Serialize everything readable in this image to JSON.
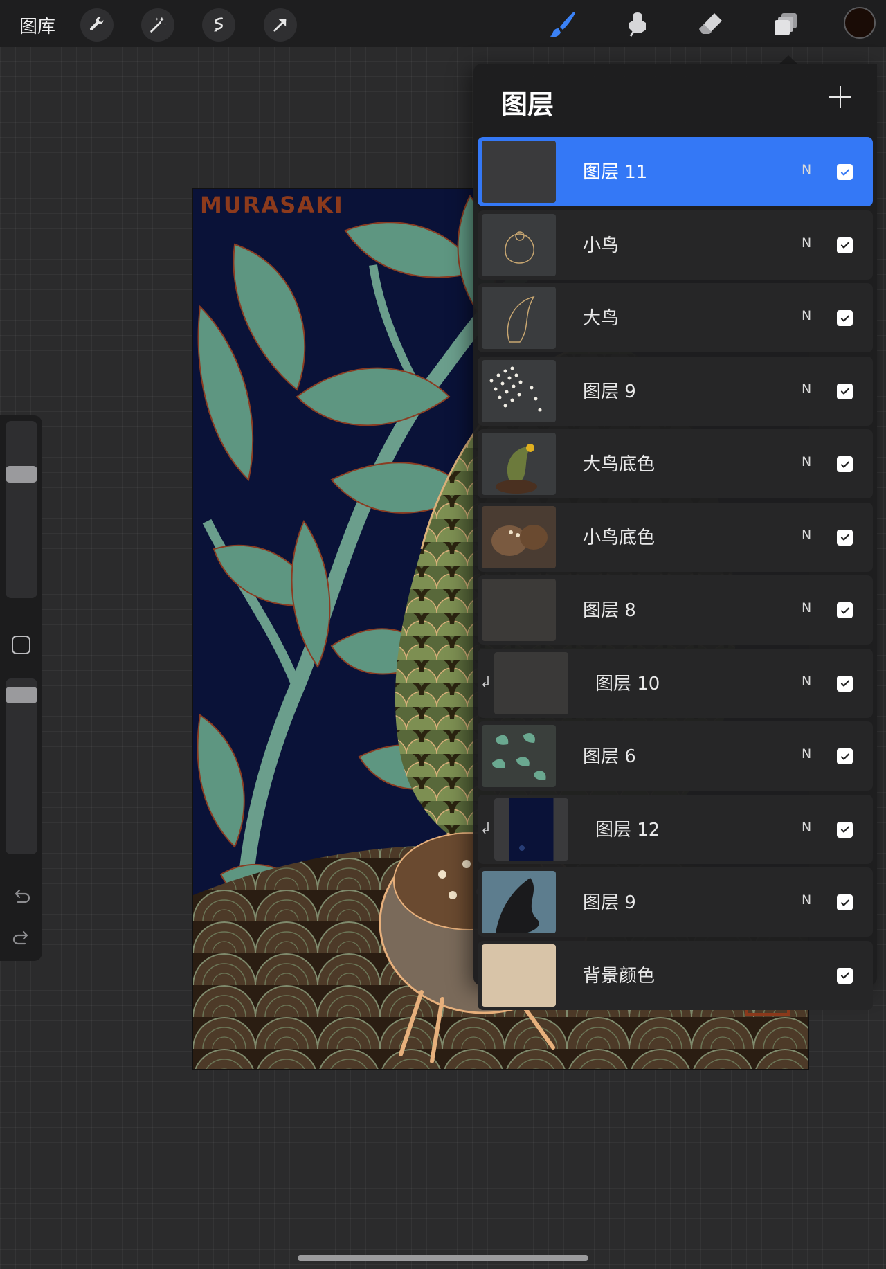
{
  "topbar": {
    "gallery_label": "图库",
    "actions": [
      "wrench-icon",
      "magic-wand-icon",
      "selection-icon",
      "transform-arrow-icon"
    ],
    "tools": [
      "brush-icon",
      "smudge-icon",
      "eraser-icon",
      "layers-icon"
    ],
    "active_tool": "brush-icon",
    "current_color": "#1a0c06",
    "accent": "#3478f6"
  },
  "sidebar": {
    "brush_size_level": 0.72,
    "opacity_level": 0.95,
    "undo_icon": "undo-icon",
    "redo_icon": "redo-icon"
  },
  "canvas": {
    "watermark": "MURASAKI",
    "background": "#0a1238"
  },
  "layers_panel": {
    "title": "图层",
    "add_icon": "plus-icon",
    "layers": [
      {
        "name": "图层 11",
        "blend": "N",
        "visible": true,
        "selected": true,
        "clipped": false
      },
      {
        "name": "小鸟",
        "blend": "N",
        "visible": true,
        "selected": false,
        "clipped": false
      },
      {
        "name": "大鸟",
        "blend": "N",
        "visible": true,
        "selected": false,
        "clipped": false
      },
      {
        "name": "图层 9",
        "blend": "N",
        "visible": true,
        "selected": false,
        "clipped": false
      },
      {
        "name": "大鸟底色",
        "blend": "N",
        "visible": true,
        "selected": false,
        "clipped": false
      },
      {
        "name": "小鸟底色",
        "blend": "N",
        "visible": true,
        "selected": false,
        "clipped": false
      },
      {
        "name": "图层 8",
        "blend": "N",
        "visible": true,
        "selected": false,
        "clipped": false
      },
      {
        "name": "图层 10",
        "blend": "N",
        "visible": true,
        "selected": false,
        "clipped": true
      },
      {
        "name": "图层 6",
        "blend": "N",
        "visible": true,
        "selected": false,
        "clipped": false
      },
      {
        "name": "图层 12",
        "blend": "N",
        "visible": true,
        "selected": false,
        "clipped": true
      },
      {
        "name": "图层 9",
        "blend": "N",
        "visible": true,
        "selected": false,
        "clipped": false
      },
      {
        "name": "背景颜色",
        "blend": "",
        "visible": true,
        "selected": false,
        "clipped": false
      }
    ]
  }
}
